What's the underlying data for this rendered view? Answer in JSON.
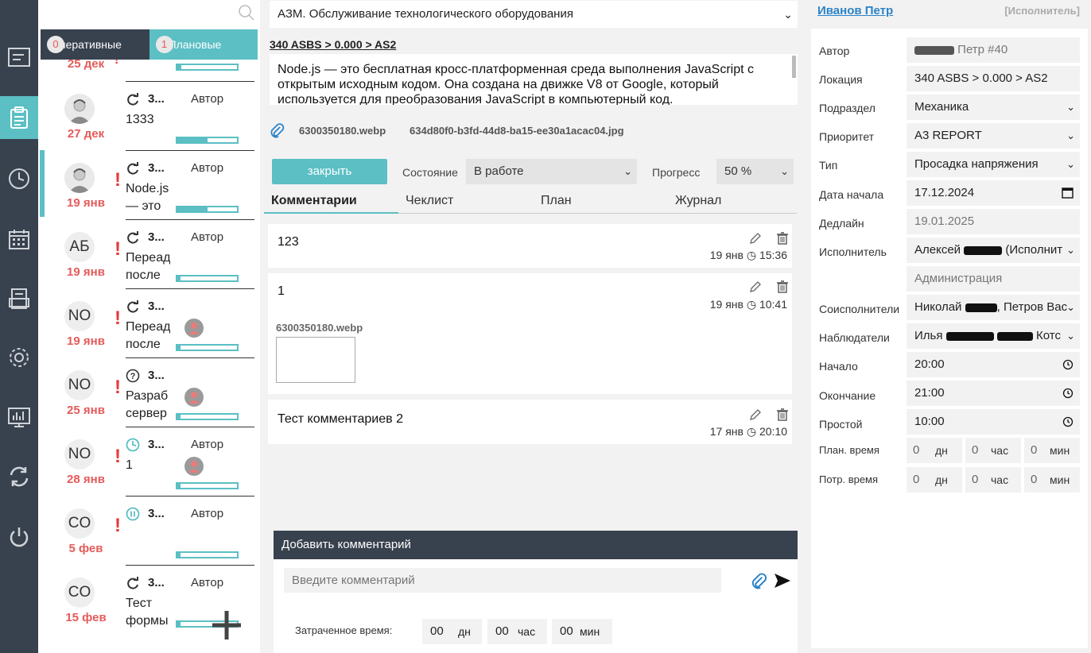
{
  "colors": {
    "accent": "#5bbfc4",
    "rail": "#38414e",
    "alert": "#e55a5a",
    "link": "#2b83c8"
  },
  "rail": {
    "icons": [
      "terminal-icon",
      "clipboard-icon",
      "clock-icon",
      "calendar-icon",
      "document-icon",
      "gear-icon",
      "monitor-chart-icon",
      "sync-icon",
      "power-icon"
    ],
    "active": "clipboard-icon"
  },
  "tasklist": {
    "tabs": [
      {
        "label": "перативные",
        "count": "0"
      },
      {
        "label": "Плановые",
        "count": "1"
      }
    ],
    "top_date": "25 дек",
    "tasks": [
      {
        "avatar": "",
        "date": "27 дек",
        "status": "refresh",
        "num": "3...",
        "author": "Автор",
        "title": "1333",
        "title2": "",
        "alert": false,
        "mini_avatar": false,
        "progress": 0.5,
        "photo": true,
        "selected": false
      },
      {
        "avatar": "",
        "date": "19 янв",
        "status": "refresh",
        "num": "3...",
        "author": "Автор",
        "title": "Node.js",
        "title2": "— это",
        "alert": true,
        "mini_avatar": false,
        "progress": 0.5,
        "photo": true,
        "selected": true
      },
      {
        "avatar": "АБ",
        "date": "19 янв",
        "status": "refresh",
        "num": "3...",
        "author": "Автор",
        "title": "Переад",
        "title2": "после",
        "alert": true,
        "mini_avatar": false,
        "progress": 0.05,
        "photo": false,
        "selected": false
      },
      {
        "avatar": "NO",
        "date": "19 янв",
        "status": "refresh",
        "num": "3...",
        "author": "",
        "title": "Переад",
        "title2": "после",
        "alert": true,
        "mini_avatar": true,
        "progress": 0.05,
        "photo": false,
        "selected": false
      },
      {
        "avatar": "NO",
        "date": "25 янв",
        "status": "question",
        "num": "3...",
        "author": "",
        "title": "Разраб",
        "title2": "сервер",
        "alert": true,
        "mini_avatar": true,
        "progress": 0.05,
        "photo": false,
        "selected": false
      },
      {
        "avatar": "NO",
        "date": "28 янв",
        "status": "clock",
        "num": "3...",
        "author": "Автор",
        "title": "1",
        "title2": "",
        "alert": true,
        "mini_avatar": true,
        "progress": 0.05,
        "photo": false,
        "selected": false
      },
      {
        "avatar": "CO",
        "date": "5 фев",
        "status": "pause",
        "num": "3...",
        "author": "Автор",
        "title": "",
        "title2": "",
        "alert": true,
        "mini_avatar": false,
        "progress": 0.05,
        "photo": false,
        "selected": false
      },
      {
        "avatar": "CO",
        "date": "15 фев",
        "status": "refresh",
        "num": "3...",
        "author": "Автор",
        "title": "Тест",
        "title2": "формы",
        "alert": false,
        "mini_avatar": false,
        "progress": 0.05,
        "photo": false,
        "selected": false
      }
    ]
  },
  "center": {
    "category": "АЗМ. Обслуживание технологического оборудования",
    "location": "340 ASBS > 0.000 > AS2",
    "description": "Node.js — это бесплатная кросс-платформенная среда выполнения JavaScript с открытым исходным кодом. Она создана на движке V8 от Google, который используется для преобразования JavaScript в компьютерный код.",
    "attachments": [
      "6300350180.webp",
      "634d80f0-b3fd-44d8-ba15-ee30a1acac04.jpg"
    ],
    "close_label": "закрыть",
    "state_label": "Состояние",
    "state_value": "В работе",
    "progress_label": "Прогресс",
    "progress_value": "50 %",
    "tabs": [
      "Комментарии",
      "Чеклист",
      "План",
      "Журнал"
    ],
    "comments": [
      {
        "text": "123",
        "date": "19 янв",
        "time": "15:36"
      },
      {
        "text": "1",
        "date": "19 янв",
        "time": "10:41",
        "attachment": "6300350180.webp"
      },
      {
        "text": "Тест комментариев 2",
        "date": "17 янв",
        "time": "20:10"
      }
    ],
    "add_comment": {
      "header": "Добавить комментарий",
      "placeholder": "Введите комментарий",
      "spent_label": "Затраченное время:",
      "days": "00",
      "days_unit": "дн",
      "hours": "00",
      "hours_unit": "час",
      "mins": "00",
      "mins_unit": "мин"
    }
  },
  "right": {
    "user": "Иванов Петр",
    "role": "[Исполнитель]",
    "fields": {
      "author_label": "Автор",
      "author_value": "Петр  #40",
      "location_label": "Локация",
      "location_value": "340 ASBS > 0.000 > AS2",
      "dept_label": "Подраздел",
      "dept_value": "Механика",
      "priority_label": "Приоритет",
      "priority_value": "A3 REPORT",
      "type_label": "Тип",
      "type_value": "Просадка напряжения",
      "start_date_label": "Дата начала",
      "start_date_value": "17.12.2024",
      "deadline_label": "Дедлайн",
      "deadline_value": "19.01.2025",
      "assignee_label": "Исполнитель",
      "assignee_first": "Алексей",
      "assignee_rest": "(Исполнит",
      "department_value": "Администрация",
      "coassignees_label": "Соисполнители",
      "coassignees_first": "Николай",
      "coassignees_rest": ", Петров Вас",
      "observers_label": "Наблюдатели",
      "observers_first": "Илья",
      "observers_rest": "Котс",
      "begin_label": "Начало",
      "begin_value": "20:00",
      "end_label": "Окончание",
      "end_value": "21:00",
      "downtime_label": "Простой",
      "downtime_value": "10:00",
      "plan_time_label": "План. время",
      "spent_time_label": "Потр. время",
      "zero": "0",
      "d": "дн",
      "h": "час",
      "m": "мин"
    }
  }
}
